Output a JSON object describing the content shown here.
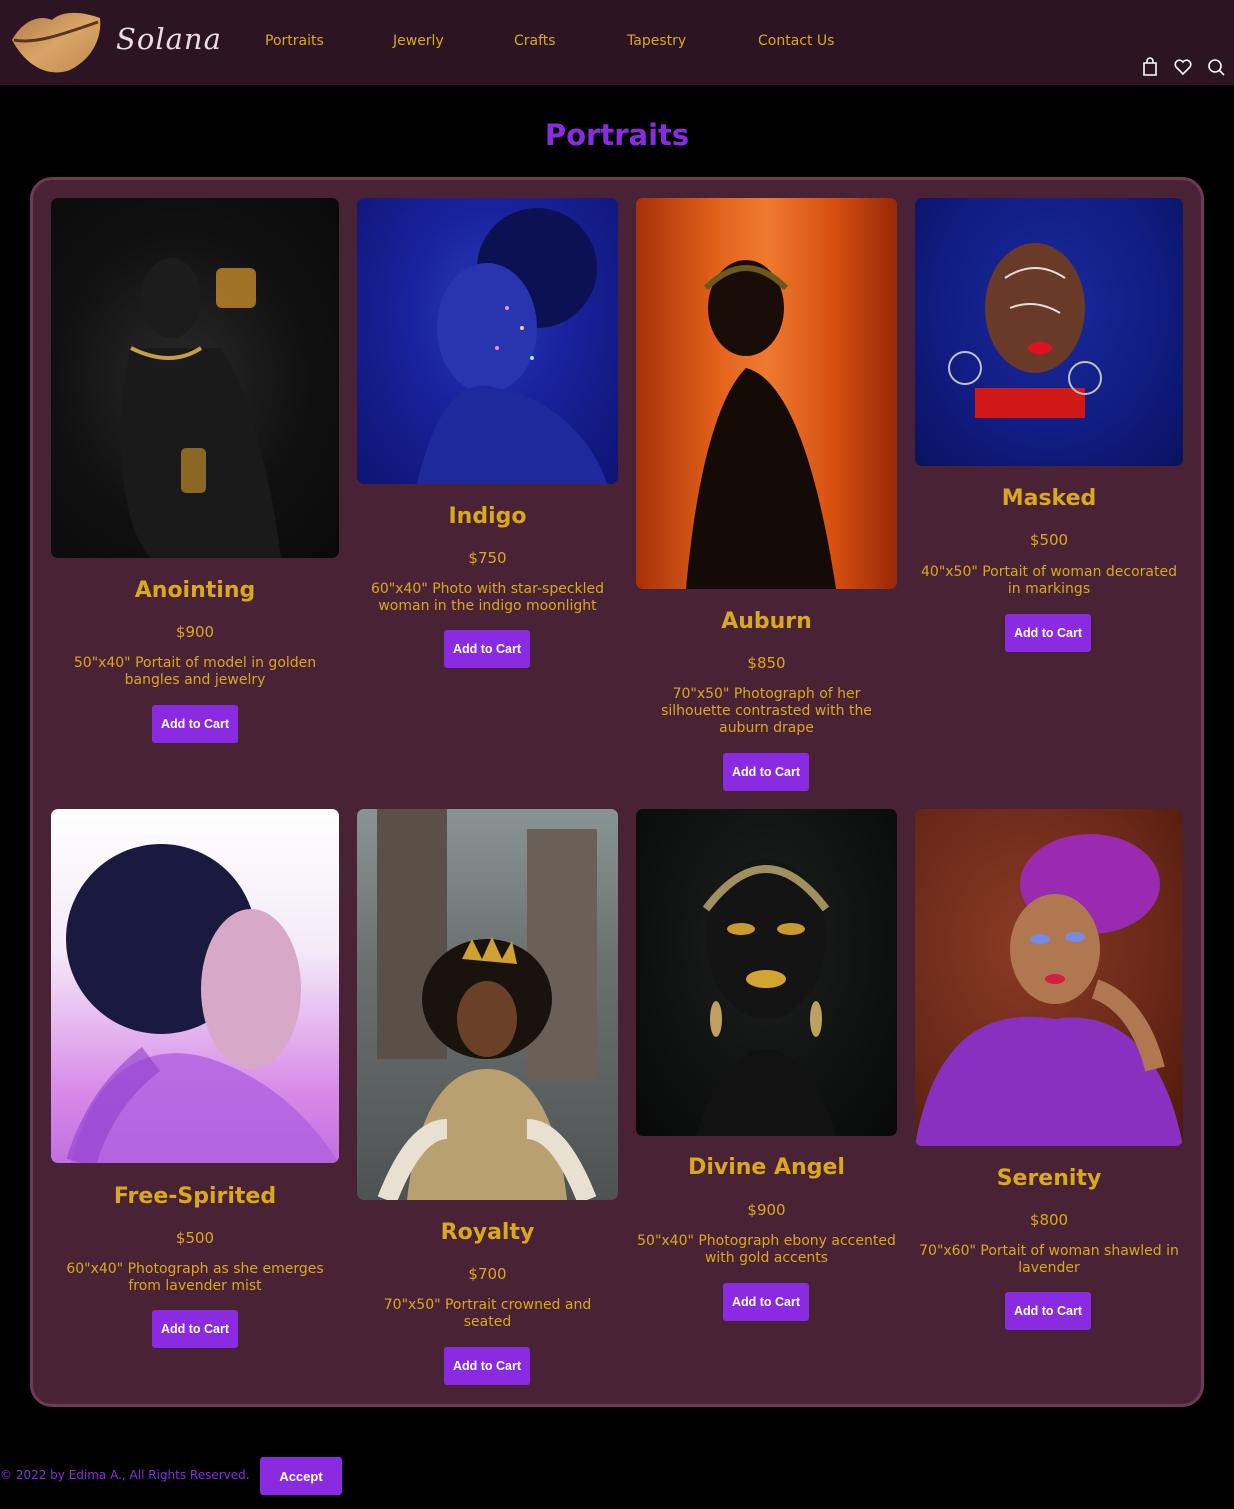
{
  "header": {
    "brand": "Solana",
    "nav": [
      "Portraits",
      "Jewerly",
      "Crafts",
      "Tapestry",
      "Contact Us"
    ],
    "icons": [
      "shopping-bag-icon",
      "heart-icon",
      "search-icon"
    ]
  },
  "page": {
    "title": "Portraits"
  },
  "colors": {
    "accent": "#8a2be2",
    "gold": "#d9a91c",
    "header_bg": "#2c1423",
    "panel_bg": "#4a2236",
    "page_bg": "#000000"
  },
  "products": [
    {
      "title": "Anointing",
      "price": "$900",
      "desc_1": "50\"x40\" Portait of model in golden",
      "desc_2": "bangles and jewelry",
      "desc_3": "",
      "button": "Add to Cart"
    },
    {
      "title": "Indigo",
      "price": "$750",
      "desc_1": "60\"x40\" Photo with star-speckled",
      "desc_2": "woman in the indigo moonlight",
      "desc_3": "",
      "button": "Add to Cart"
    },
    {
      "title": "Auburn",
      "price": "$850",
      "desc_1": "70\"x50\" Photograph of her",
      "desc_2": "silhouette contrasted with the",
      "desc_3": "auburn drape",
      "button": "Add to Cart"
    },
    {
      "title": "Masked",
      "price": "$500",
      "desc_1": "40\"x50\" Portait of woman decorated",
      "desc_2": "in markings",
      "desc_3": "",
      "button": "Add to Cart"
    },
    {
      "title": "Free-Spirited",
      "price": "$500",
      "desc_1": "60\"x40\" Photograph as she emerges",
      "desc_2": "from lavender mist",
      "desc_3": "",
      "button": "Add to Cart"
    },
    {
      "title": "Royalty",
      "price": "$700",
      "desc_1": "70\"x50\" Portrait crowned and",
      "desc_2": "seated",
      "desc_3": "",
      "button": "Add to Cart"
    },
    {
      "title": "Divine Angel",
      "price": "$900",
      "desc_1": "50\"x40\" Photograph ebony accented",
      "desc_2": "with gold accents",
      "desc_3": "",
      "button": "Add to Cart"
    },
    {
      "title": "Serenity",
      "price": "$800",
      "desc_1": "70\"x60\" Portait of woman shawled in",
      "desc_2": "lavender",
      "desc_3": "",
      "button": "Add to Cart"
    }
  ],
  "footer": {
    "copyright": "© 2022 by Edima A., All Rights Reserved.",
    "accept": "Accept"
  }
}
